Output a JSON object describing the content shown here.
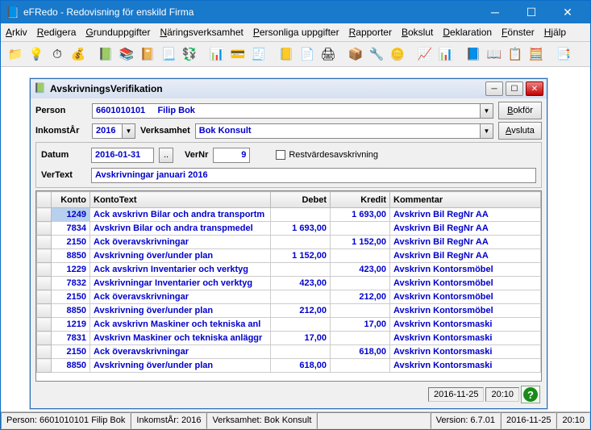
{
  "window": {
    "title": "eFRedo - Redovisning för enskild Firma"
  },
  "menu": [
    "Arkiv",
    "Redigera",
    "Grunduppgifter",
    "Näringsverksamhet",
    "Personliga uppgifter",
    "Rapporter",
    "Bokslut",
    "Deklaration",
    "Fönster",
    "Hjälp"
  ],
  "child": {
    "title": "AvskrivningsVerifikation"
  },
  "labels": {
    "person": "Person",
    "inkomstar": "InkomstÅr",
    "verksamhet": "Verksamhet",
    "datum": "Datum",
    "vernr": "VerNr",
    "vertext": "VerText",
    "restvarde": "Restvärdesavskrivning",
    "bokfor": "Bokför",
    "avsluta": "Avsluta"
  },
  "fields": {
    "person": "6601010101     Filip Bok",
    "inkomstar": "2016",
    "verksamhet": "Bok Konsult",
    "datum": "2016-01-31",
    "vernr": "9",
    "vertext": "Avskrivningar januari 2016"
  },
  "grid": {
    "headers": [
      "Konto",
      "KontoText",
      "Debet",
      "Kredit",
      "Kommentar"
    ],
    "rows": [
      {
        "konto": "1249",
        "text": "Ack avskrivn Bilar och andra transportm",
        "debet": "",
        "kredit": "1 693,00",
        "komm": "Avskrivn Bil RegNr AA",
        "sel": true
      },
      {
        "konto": "7834",
        "text": "Avskrivn Bilar och andra transpmedel",
        "debet": "1 693,00",
        "kredit": "",
        "komm": "Avskrivn Bil RegNr AA"
      },
      {
        "konto": "2150",
        "text": "Ack överavskrivningar",
        "debet": "",
        "kredit": "1 152,00",
        "komm": "Avskrivn Bil RegNr AA"
      },
      {
        "konto": "8850",
        "text": "Avskrivning över/under plan",
        "debet": "1 152,00",
        "kredit": "",
        "komm": "Avskrivn Bil RegNr AA"
      },
      {
        "konto": "1229",
        "text": "Ack avskrivn Inventarier och verktyg",
        "debet": "",
        "kredit": "423,00",
        "komm": "Avskrivn Kontorsmöbel"
      },
      {
        "konto": "7832",
        "text": "Avskrivningar Inventarier och verktyg",
        "debet": "423,00",
        "kredit": "",
        "komm": "Avskrivn Kontorsmöbel"
      },
      {
        "konto": "2150",
        "text": "Ack överavskrivningar",
        "debet": "",
        "kredit": "212,00",
        "komm": "Avskrivn Kontorsmöbel"
      },
      {
        "konto": "8850",
        "text": "Avskrivning över/under plan",
        "debet": "212,00",
        "kredit": "",
        "komm": "Avskrivn Kontorsmöbel"
      },
      {
        "konto": "1219",
        "text": "Ack avskrivn Maskiner och tekniska anl",
        "debet": "",
        "kredit": "17,00",
        "komm": "Avskrivn Kontorsmaski"
      },
      {
        "konto": "7831",
        "text": "Avskrivn Maskiner och tekniska anläggr",
        "debet": "17,00",
        "kredit": "",
        "komm": "Avskrivn Kontorsmaski"
      },
      {
        "konto": "2150",
        "text": "Ack överavskrivningar",
        "debet": "",
        "kredit": "618,00",
        "komm": "Avskrivn Kontorsmaski"
      },
      {
        "konto": "8850",
        "text": "Avskrivning över/under plan",
        "debet": "618,00",
        "kredit": "",
        "komm": "Avskrivn Kontorsmaski"
      }
    ]
  },
  "child_status": {
    "date": "2016-11-25",
    "time": "20:10"
  },
  "statusbar": {
    "person": "Person: 6601010101  Filip Bok",
    "inkomstar": "InkomstÅr: 2016",
    "verksamhet": "Verksamhet: Bok Konsult",
    "version": "Version: 6.7.01",
    "date": "2016-11-25",
    "time": "20:10"
  },
  "toolbar_icons": [
    "📁",
    "💡",
    "⏱",
    "💰",
    "📗",
    "📚",
    "📔",
    "📃",
    "💱",
    "📊",
    "💳",
    "🧾",
    "📒",
    "📄",
    "🖨",
    "📦",
    "🔧",
    "🪙",
    "📈",
    "📊",
    "📘",
    "📖",
    "📋",
    "🧮",
    "📑"
  ]
}
